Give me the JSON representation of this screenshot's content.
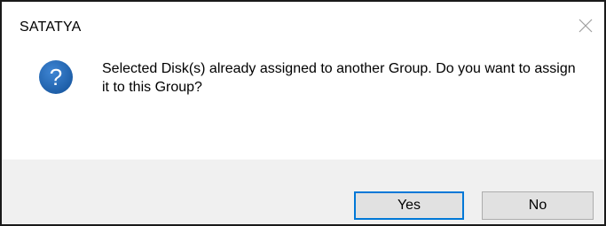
{
  "window": {
    "title": "SATATYA"
  },
  "icons": {
    "close": "close-icon",
    "message": "question-icon",
    "message_glyph": "?",
    "message_color": "#1f5fa8"
  },
  "message": {
    "text": "Selected Disk(s) already assigned to another Group. Do you want to assign it to this Group?"
  },
  "buttons": {
    "yes_label": "Yes",
    "no_label": "No",
    "default_accent": "#0078d7"
  }
}
